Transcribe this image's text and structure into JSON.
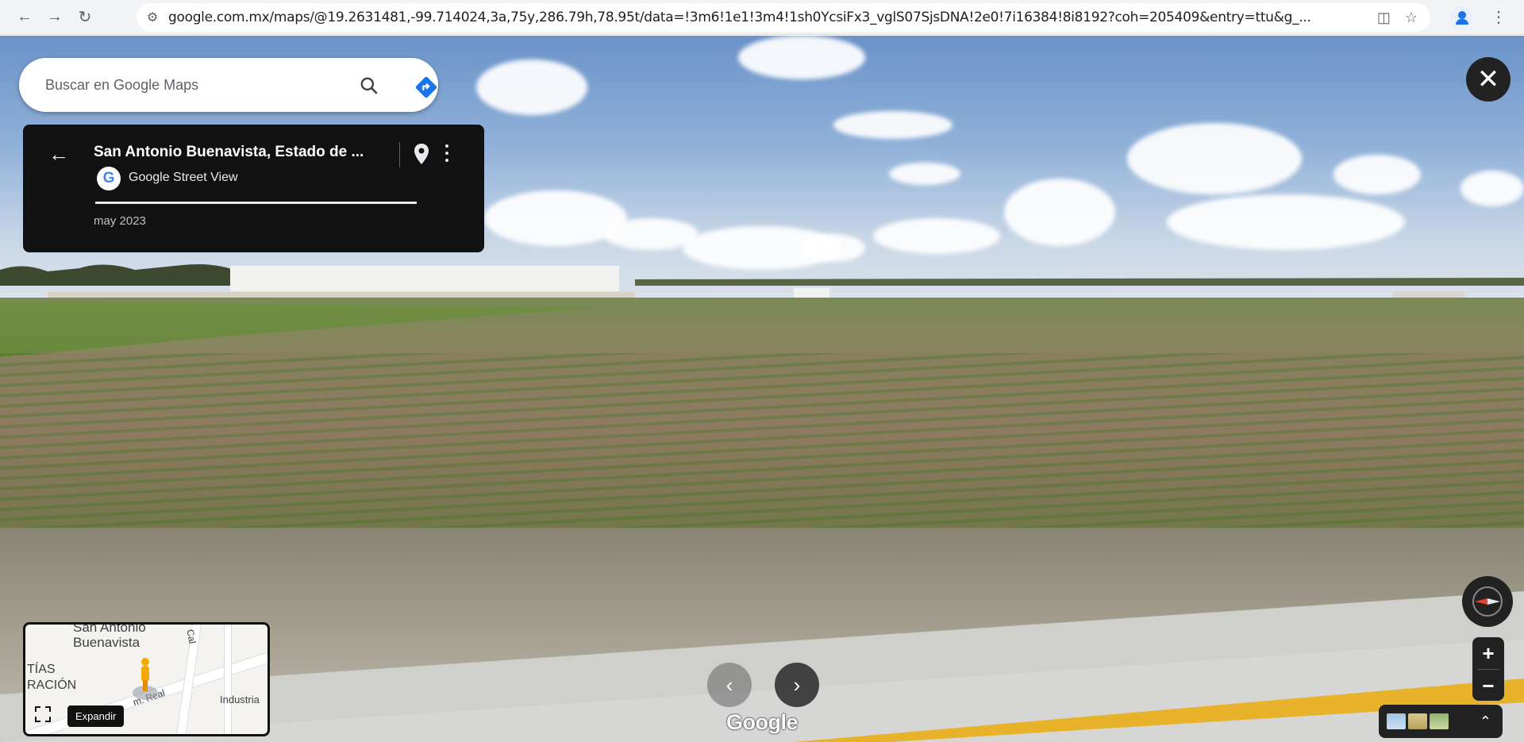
{
  "browser": {
    "url": "google.com.mx/maps/@19.2631481,-99.714024,3a,75y,286.79h,78.95t/data=!3m6!1e1!3m4!1sh0YcsiFx3_vglS07SjsDNA!2e0!7i16384!8i8192?coh=205409&entry=ttu&g_..."
  },
  "search": {
    "placeholder": "Buscar en Google Maps"
  },
  "infocard": {
    "title": "San Antonio Buenavista, Estado de ...",
    "source": "Google Street View",
    "date": "may 2023"
  },
  "minimap": {
    "place_line1": "San Antonio",
    "place_line2": "Buenavista",
    "left_line1": "TÍAS",
    "left_line2": "RACIÓN",
    "road_camreal": "m. Real",
    "road_cal": "Cal",
    "road_industria": "Industria",
    "expand_label": "Expandir"
  },
  "footer": {
    "brand": "Google"
  },
  "controls": {
    "zoom_in": "+",
    "zoom_out": "−",
    "close": "✕"
  },
  "colors": {
    "accent": "#1a73e8",
    "card_bg": "#111111"
  }
}
